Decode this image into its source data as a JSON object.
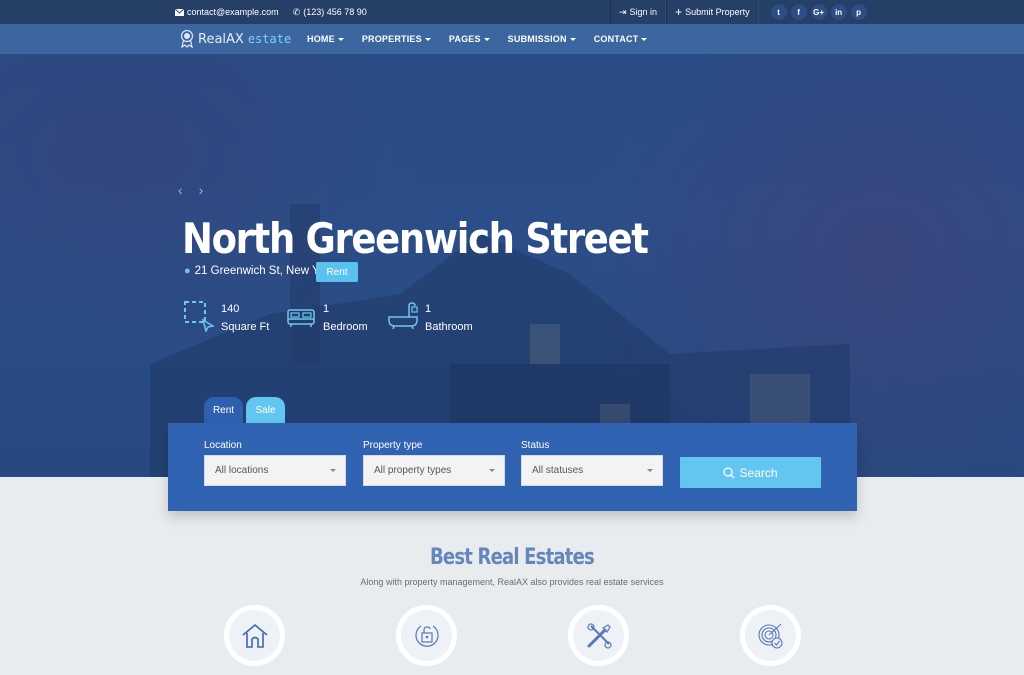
{
  "topbar": {
    "email": "contact@example.com",
    "phone": "(123) 456 78 90",
    "sign_in": "Sign in",
    "submit_property": "Submit Property",
    "social": [
      {
        "icon": "twitter-icon",
        "glyph": "t"
      },
      {
        "icon": "facebook-icon",
        "glyph": "f"
      },
      {
        "icon": "google-plus-icon",
        "glyph": "G+"
      },
      {
        "icon": "linkedin-icon",
        "glyph": "in"
      },
      {
        "icon": "pinterest-icon",
        "glyph": "p"
      }
    ]
  },
  "navbar": {
    "brand_main": "RealAX",
    "brand_sub": "estate",
    "menu": [
      "HOME",
      "PROPERTIES",
      "PAGES",
      "SUBMISSION",
      "CONTACT"
    ]
  },
  "hero": {
    "prev": "‹",
    "next": "›",
    "title": "North Greenwich Street",
    "address": "21 Greenwich St, New York",
    "badge": "Rent",
    "features": [
      {
        "icon": "area-select-icon",
        "value": "140",
        "label": "Square Ft"
      },
      {
        "icon": "bed-icon",
        "value": "1",
        "label": "Bedroom"
      },
      {
        "icon": "bathtub-icon",
        "value": "1",
        "label": "Bathroom"
      }
    ]
  },
  "search": {
    "tabs": [
      "Rent",
      "Sale"
    ],
    "active_tab": "Rent",
    "fields": [
      {
        "label": "Location",
        "value": "All locations"
      },
      {
        "label": "Property type",
        "value": "All property types"
      },
      {
        "label": "Status",
        "value": "All statuses"
      }
    ],
    "button": "Search"
  },
  "section": {
    "title": "Best Real Estates",
    "subtitle": "Along with property management, RealAX also provides real estate services",
    "services": [
      "home-icon",
      "unlock-icon",
      "tools-icon",
      "target-icon"
    ]
  },
  "colors": {
    "topbar": "#263f67",
    "navbar": "#3c66a0",
    "panel": "#3063b2",
    "accent": "#63c6f0",
    "section_title": "#6486ba"
  }
}
